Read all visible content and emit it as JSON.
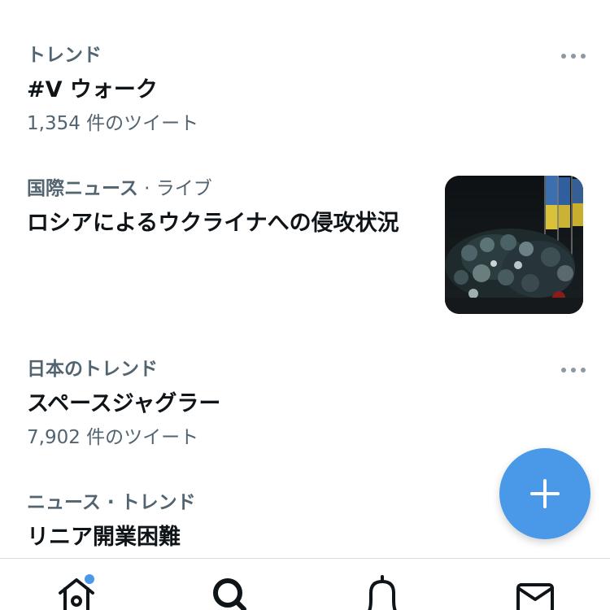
{
  "trends": [
    {
      "meta": "トレンド",
      "meta_sub": "",
      "title": "#V ウォーク",
      "count": "1,354 件のツイート",
      "has_more": true,
      "has_thumbnail": false
    },
    {
      "meta": "国際ニュース",
      "meta_sub": " · ライブ",
      "title": "ロシアによるウクライナへの侵攻状況",
      "count": "",
      "has_more": false,
      "has_thumbnail": true
    },
    {
      "meta": "日本のトレンド",
      "meta_sub": "",
      "title": "スペースジャグラー",
      "count": "7,902 件のツイート",
      "has_more": true,
      "has_thumbnail": false
    },
    {
      "meta": "ニュース · トレンド",
      "meta_sub": "",
      "title": "リニア開業困難",
      "count": "",
      "has_more": false,
      "has_thumbnail": false
    }
  ],
  "fab": {
    "icon": "plus-icon",
    "color": "#4a99e9"
  },
  "tabbar": {
    "items": [
      {
        "name": "home",
        "icon": "home-icon",
        "has_notification_dot": true
      },
      {
        "name": "search",
        "icon": "search-icon",
        "active": true
      },
      {
        "name": "notifications",
        "icon": "bell-icon"
      },
      {
        "name": "messages",
        "icon": "mail-icon"
      }
    ]
  },
  "colors": {
    "accent": "#4a99e9",
    "primary_text": "#0f1419",
    "secondary_text": "#536471"
  }
}
